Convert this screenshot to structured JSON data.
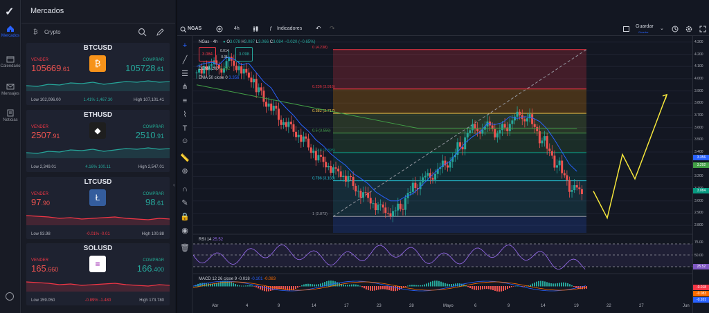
{
  "nav": {
    "logo": "checkmark-logo",
    "items": [
      {
        "label": "Mercados",
        "icon": "home-icon",
        "active": true
      },
      {
        "label": "Calendario",
        "icon": "calendar-icon",
        "active": false
      },
      {
        "label": "Mensajes",
        "icon": "mail-icon",
        "active": false
      },
      {
        "label": "Noticias",
        "icon": "news-icon",
        "active": false
      }
    ]
  },
  "panel": {
    "title": "Mercados",
    "category": "Crypto",
    "sell_label": "VENDER",
    "buy_label": "COMPRAR",
    "cards": [
      {
        "symbol": "BTCUSD",
        "sell_main": "105669",
        "sell_dec": ".61",
        "buy_main": "105728",
        "buy_dec": ".61",
        "low": "Low 102,096.00",
        "change": "1.41%  1,467.30",
        "high": "High 107,101.41",
        "up": true,
        "icon_color": "#f7931a",
        "icon_glyph": "₿"
      },
      {
        "symbol": "ETHUSD",
        "sell_main": "2507",
        "sell_dec": ".91",
        "buy_main": "2510",
        "buy_dec": ".91",
        "low": "Low 2,349.01",
        "change": "4.16%  100.11",
        "high": "High 2,547.01",
        "up": true,
        "icon_color": "#1e1e1e",
        "icon_glyph": "◆"
      },
      {
        "symbol": "LTCUSD",
        "sell_main": "97",
        "sell_dec": ".90",
        "buy_main": "98",
        "buy_dec": ".61",
        "low": "Low 93.98",
        "change": "-0.01%  -0.01",
        "high": "High 100.88",
        "up": false,
        "icon_color": "#345d9d",
        "icon_glyph": "Ł"
      },
      {
        "symbol": "SOLUSD",
        "sell_main": "165",
        "sell_dec": ".660",
        "buy_main": "166",
        "buy_dec": ".400",
        "low": "Low 159.050",
        "change": "-0.89%  -1.480",
        "high": "High 173.780",
        "up": false,
        "icon_color": "#ffffff",
        "icon_glyph": "≡"
      }
    ]
  },
  "toolbar": {
    "symbol": "NGAS",
    "interval": "4h",
    "indicators": "Indicadores",
    "save": "Guardar",
    "save_sub": "Guardar"
  },
  "legend": {
    "name": "NGas · 4h",
    "o": "O",
    "o_val": "3.078",
    "h": "H",
    "h_val": "3.087",
    "l": "L",
    "l_val": "3.066",
    "c": "C",
    "c_val": "3.084",
    "chg": "−0.020 (−0.65%)",
    "sell": "3.084",
    "spread1": "0.014",
    "spread2": "0.01",
    "buy": "3.098",
    "dema": "DEMA",
    "dema_val": "200",
    "dema_v": "3.292",
    "ema": "EMA 50 close 0",
    "ema_v": "3.356"
  },
  "fib": [
    {
      "label": "0 (4.238)",
      "price": 4.238,
      "color": "#f23645"
    },
    {
      "label": "0.236 (3.916)",
      "price": 3.916,
      "color": "#f23645"
    },
    {
      "label": "0.382 (3.717)",
      "price": 3.717,
      "color": "#f7c948"
    },
    {
      "label": "0.5 (3.556)",
      "price": 3.556,
      "color": "#4caf50"
    },
    {
      "label": "0.618 (3.395)",
      "price": 3.395,
      "color": "#089981"
    },
    {
      "label": "0.786 (3.165)",
      "price": 3.165,
      "color": "#26c6da"
    },
    {
      "label": "1 (2.873)",
      "price": 2.873,
      "color": "#9598a1"
    }
  ],
  "price_scale": [
    "4.300",
    "4.200",
    "4.100",
    "4.000",
    "3.900",
    "3.800",
    "3.700",
    "3.600",
    "3.500",
    "3.400",
    "3.300",
    "3.200",
    "3.100",
    "3.000",
    "2.900",
    "2.800"
  ],
  "price_tags": [
    {
      "text": "3.356",
      "color": "#2962ff",
      "price": 3.356
    },
    {
      "text": "3.292",
      "color": "#43a047",
      "price": 3.292
    },
    {
      "text": "3.084",
      "color": "#089981",
      "price": 3.084
    }
  ],
  "rsi": {
    "label": "RSI",
    "period": "14",
    "value": "25.52",
    "levels": [
      "75.00",
      "50.00"
    ],
    "tag": "25.52"
  },
  "macd": {
    "label": "MACD",
    "params": "12 26 close 9",
    "v1": "-0.018",
    "v2": "-0.101",
    "v3": "-0.083",
    "tags": [
      "-0.018",
      "-0.083",
      "-0.101"
    ]
  },
  "time_labels": [
    "Abr",
    "4",
    "9",
    "14",
    "17",
    "23",
    "28",
    "Mayo",
    "6",
    "9",
    "14",
    "19",
    "22",
    "27",
    "Jun"
  ],
  "colors": {
    "up": "#26a69a",
    "down": "#ef5350",
    "bg": "#131722",
    "accent": "#2962ff",
    "projection": "#f5e63b"
  },
  "chart_data": {
    "type": "candlestick",
    "symbol": "NGAS",
    "interval": "4h",
    "ylim": [
      2.75,
      4.35
    ],
    "fib_range": [
      2.873,
      4.238
    ],
    "close_path": [
      4.05,
      4.1,
      4.12,
      4.08,
      4.15,
      4.1,
      4.05,
      4.0,
      3.9,
      3.8,
      3.75,
      3.65,
      3.62,
      3.55,
      3.5,
      3.42,
      3.35,
      3.3,
      3.25,
      3.22,
      3.18,
      3.1,
      3.05,
      3.0,
      2.95,
      2.92,
      2.9,
      2.95,
      3.05,
      3.12,
      3.18,
      3.2,
      3.25,
      3.3,
      3.35,
      3.45,
      3.55,
      3.6,
      3.58,
      3.62,
      3.55,
      3.6,
      3.66,
      3.7,
      3.68,
      3.6,
      3.5,
      3.4,
      3.3,
      3.2,
      3.1,
      3.084
    ],
    "projection": [
      3.08,
      2.86,
      3.38,
      3.18,
      3.87
    ]
  }
}
